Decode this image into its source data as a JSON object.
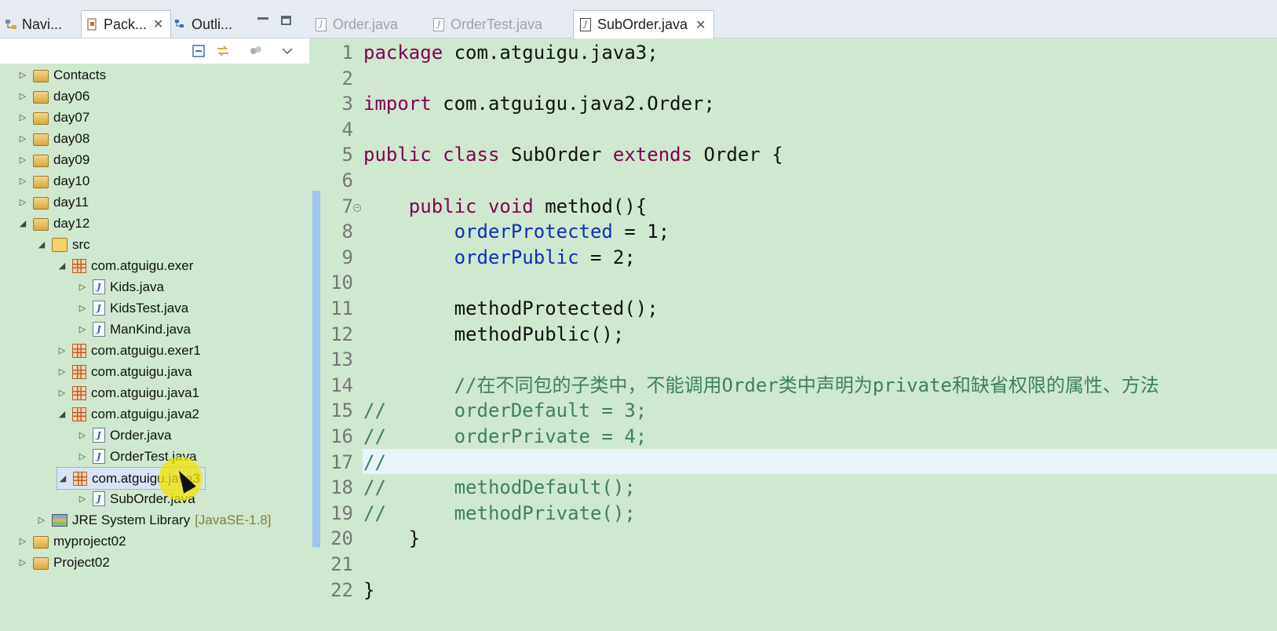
{
  "left_tabs": {
    "navigator": "Navi...",
    "package_explorer": "Pack...",
    "outline": "Outli..."
  },
  "tree": [
    {
      "label": "Contacts",
      "type": "project",
      "level": 0,
      "expanded": false
    },
    {
      "label": "day06",
      "type": "project",
      "level": 0,
      "expanded": false
    },
    {
      "label": "day07",
      "type": "project",
      "level": 0,
      "expanded": false
    },
    {
      "label": "day08",
      "type": "project",
      "level": 0,
      "expanded": false
    },
    {
      "label": "day09",
      "type": "project",
      "level": 0,
      "expanded": false
    },
    {
      "label": "day10",
      "type": "project",
      "level": 0,
      "expanded": false
    },
    {
      "label": "day11",
      "type": "project",
      "level": 0,
      "expanded": false
    },
    {
      "label": "day12",
      "type": "project",
      "level": 0,
      "expanded": true
    },
    {
      "label": "src",
      "type": "src",
      "level": 1,
      "expanded": true
    },
    {
      "label": "com.atguigu.exer",
      "type": "package",
      "level": 2,
      "expanded": true
    },
    {
      "label": "Kids.java",
      "type": "java",
      "level": 3,
      "expanded": false
    },
    {
      "label": "KidsTest.java",
      "type": "java",
      "level": 3,
      "expanded": false
    },
    {
      "label": "ManKind.java",
      "type": "java",
      "level": 3,
      "expanded": false
    },
    {
      "label": "com.atguigu.exer1",
      "type": "package",
      "level": 2,
      "expanded": false
    },
    {
      "label": "com.atguigu.java",
      "type": "package",
      "level": 2,
      "expanded": false
    },
    {
      "label": "com.atguigu.java1",
      "type": "package",
      "level": 2,
      "expanded": false
    },
    {
      "label": "com.atguigu.java2",
      "type": "package",
      "level": 2,
      "expanded": true
    },
    {
      "label": "Order.java",
      "type": "java",
      "level": 3,
      "expanded": false
    },
    {
      "label": "OrderTest.java",
      "type": "java",
      "level": 3,
      "expanded": false
    },
    {
      "label": "com.atguigu.java3",
      "type": "package",
      "level": 2,
      "expanded": true,
      "selected": true
    },
    {
      "label": "SubOrder.java",
      "type": "java",
      "level": 3,
      "expanded": false
    },
    {
      "label": "JRE System Library",
      "suffix": "[JavaSE-1.8]",
      "type": "library",
      "level": 1,
      "expanded": false
    },
    {
      "label": "myproject02",
      "type": "project",
      "level": 0,
      "expanded": false
    },
    {
      "label": "Project02",
      "type": "project",
      "level": 0,
      "expanded": false
    }
  ],
  "editor_tabs": {
    "order": "Order.java",
    "ordertest": "OrderTest.java",
    "suborder": "SubOrder.java"
  },
  "code_lines": [
    [
      {
        "t": "package ",
        "c": "kw"
      },
      {
        "t": "com.atguigu.java3;",
        "c": ""
      }
    ],
    [],
    [
      {
        "t": "import ",
        "c": "kw"
      },
      {
        "t": "com.atguigu.java2.Order;",
        "c": ""
      }
    ],
    [],
    [
      {
        "t": "public ",
        "c": "kw"
      },
      {
        "t": "class ",
        "c": "kw"
      },
      {
        "t": "SubOrder ",
        "c": ""
      },
      {
        "t": "extends ",
        "c": "kw"
      },
      {
        "t": "Order {",
        "c": ""
      }
    ],
    [],
    [
      {
        "t": "    ",
        "c": ""
      },
      {
        "t": "public ",
        "c": "kw"
      },
      {
        "t": "void ",
        "c": "kw"
      },
      {
        "t": "method(){",
        "c": ""
      }
    ],
    [
      {
        "t": "        ",
        "c": ""
      },
      {
        "t": "orderProtected",
        "c": "fld"
      },
      {
        "t": " = 1;",
        "c": ""
      }
    ],
    [
      {
        "t": "        ",
        "c": ""
      },
      {
        "t": "orderPublic",
        "c": "fld"
      },
      {
        "t": " = 2;",
        "c": ""
      }
    ],
    [],
    [
      {
        "t": "        methodProtected();",
        "c": ""
      }
    ],
    [
      {
        "t": "        methodPublic();",
        "c": ""
      }
    ],
    [],
    [
      {
        "t": "        //在不同包的子类中，不能调用Order类中声明为private和缺省权限的属性、方法",
        "c": "cm"
      }
    ],
    [
      {
        "t": "//      orderDefault = 3;",
        "c": "cm"
      }
    ],
    [
      {
        "t": "//      orderPrivate = 4;",
        "c": "cm"
      }
    ],
    [
      {
        "t": "//",
        "c": "cm"
      }
    ],
    [
      {
        "t": "//      methodDefault();",
        "c": "cm"
      }
    ],
    [
      {
        "t": "//      methodPrivate();",
        "c": "cm"
      }
    ],
    [
      {
        "t": "    }",
        "c": ""
      }
    ],
    [],
    [
      {
        "t": "}",
        "c": ""
      }
    ]
  ]
}
